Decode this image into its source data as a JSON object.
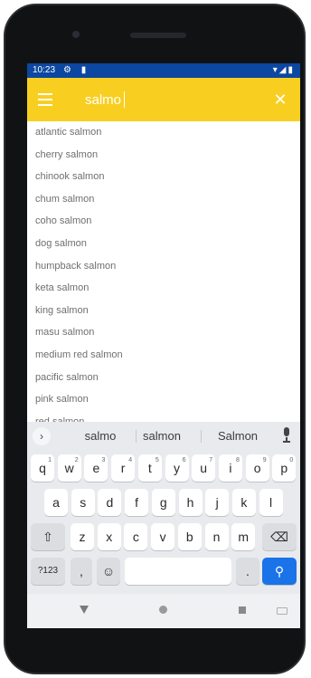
{
  "status_bar": {
    "time": "10:23",
    "left_icons": "⚙ ▮",
    "right_icons": "▾◢▮"
  },
  "search": {
    "value": "salmo"
  },
  "suggestions": [
    "atlantic salmon",
    "cherry salmon",
    "chinook salmon",
    "chum salmon",
    "coho salmon",
    "dog salmon",
    "humpback salmon",
    "keta salmon",
    "king salmon",
    "masu salmon",
    "medium red salmon",
    "pacific salmon",
    "pink salmon",
    "red salmon"
  ],
  "keyboard": {
    "suggestion_words": [
      "salmo",
      "salmon",
      "Salmon"
    ],
    "expand_label": "›",
    "row1": [
      "q",
      "w",
      "e",
      "r",
      "t",
      "y",
      "u",
      "i",
      "o",
      "p"
    ],
    "row1_numbers": [
      "1",
      "2",
      "3",
      "4",
      "5",
      "6",
      "7",
      "8",
      "9",
      "0"
    ],
    "row2": [
      "a",
      "s",
      "d",
      "f",
      "g",
      "h",
      "j",
      "k",
      "l"
    ],
    "row3": [
      "z",
      "x",
      "c",
      "v",
      "b",
      "n",
      "m"
    ],
    "shift_label": "⇧",
    "backspace_label": "⌫",
    "symbols_label": "?123",
    "comma_label": ",",
    "emoji_label": "☺",
    "period_label": ".",
    "search_label": "⚲"
  },
  "icons": {
    "menu": "menu-icon",
    "close": "close-icon",
    "mic": "mic-icon",
    "back": "back-triangle-icon",
    "home": "home-circle-icon",
    "recent": "recent-square-icon"
  },
  "colors": {
    "appbar": "#f8cf21",
    "status_bar": "#0c47a1",
    "enter_key": "#1a73e8"
  }
}
